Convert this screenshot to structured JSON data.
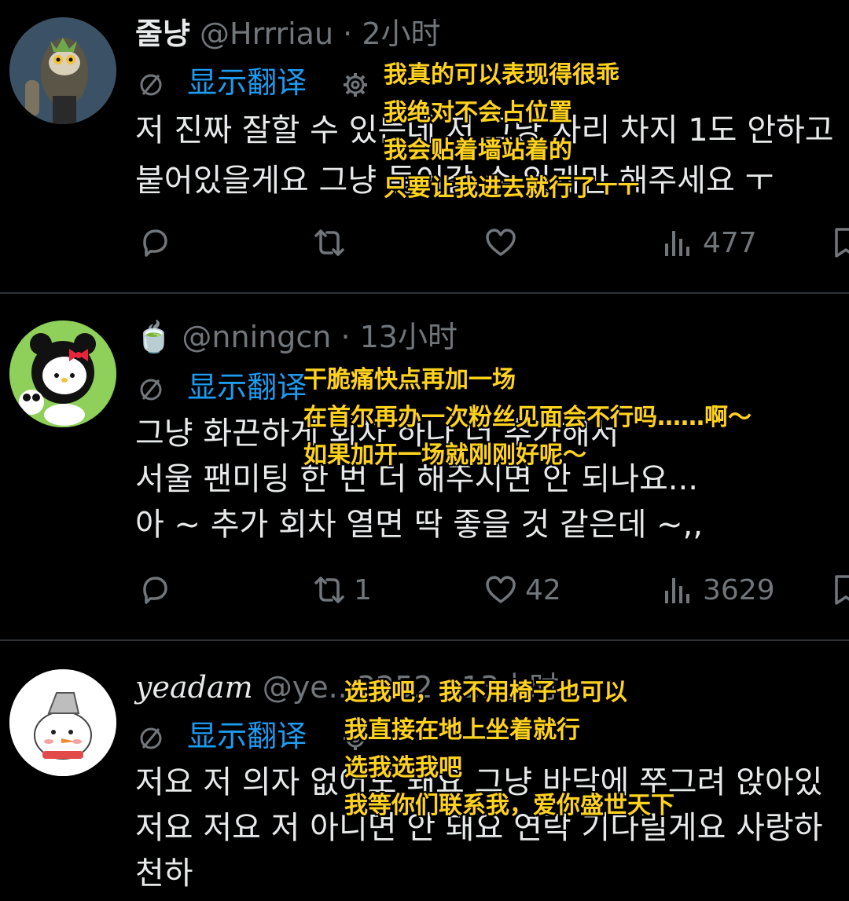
{
  "tweets": [
    {
      "name": "줄냥",
      "handle": "@Hrrriau",
      "dot": "·",
      "time": "2小时",
      "translate_label": "显示翻译",
      "body_lines": [
        "저 진짜 잘할 수 있는데 저 그냥 자리 차지 1도 안하고",
        "붙어있을게요 그냥 들어갈 수 있게만 해주세요 ㅜ"
      ],
      "replies": "",
      "retweets": "",
      "likes": "",
      "views": "477",
      "subtitle": [
        "我真的可以表现得很乖",
        "我绝对不会占位置",
        "我会贴着墙站着的",
        "只要让我进去就行了ㅜㅜ"
      ]
    },
    {
      "name": "🍵",
      "handle": "@nningcn",
      "dot": "·",
      "time": "13小时",
      "translate_label": "显示翻译",
      "body_lines": [
        "그냥 화끈하게 회차 하나 더 추가해서",
        "서울 팬미팅 한 번 더 해주시면 안 되나요...",
        "아 ~ 추가 회차 열면 딱 좋을 것 같은데 ~,,"
      ],
      "replies": "",
      "retweets": "1",
      "likes": "42",
      "views": "3629",
      "subtitle": [
        "干脆痛快点再加一场",
        "在首尔再办一次粉丝见面会不行吗……啊～",
        "如果加开一场就刚刚好呢～"
      ]
    },
    {
      "name": "yeadam",
      "handle": "@ye...3252",
      "dot": "·",
      "time": "13小时",
      "translate_label": "显示翻译",
      "body_lines": [
        "저요 저 의자 없어도 돼요 그냥 바닥에 쭈그려 앉아있",
        "저요 저요 저 아니면 안 돼요 연락 기다릴게요 사랑하",
        "천하"
      ],
      "subtitle": [
        "选我吧，我不用椅子也可以",
        "我直接在地上坐着就行",
        "选我选我吧",
        "我等你们联系我，爱你盛世天下"
      ]
    }
  ],
  "colors": {
    "link": "#1d9bf0",
    "muted": "#71767b",
    "text": "#e7e9ea",
    "subtitle": "#ffd21e"
  },
  "icons": [
    "reply-icon",
    "retweet-icon",
    "like-icon",
    "views-icon",
    "bookmark-icon",
    "no-translate-icon",
    "gear-icon"
  ]
}
